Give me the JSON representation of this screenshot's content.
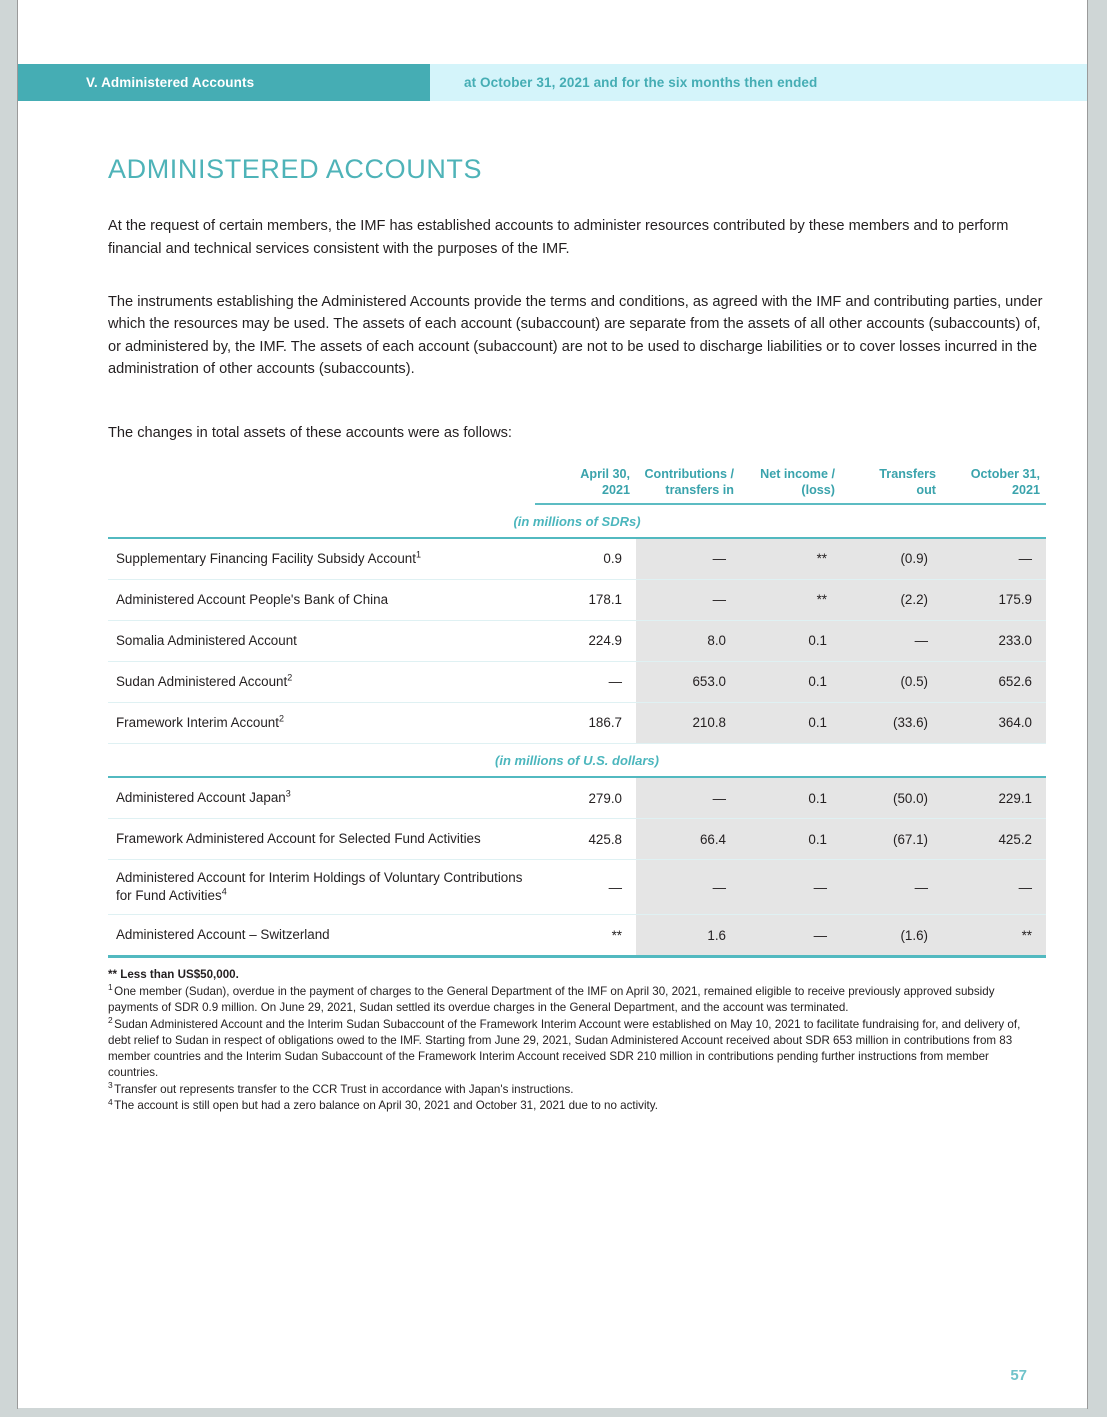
{
  "document": {
    "running_header_left": "V. Administered Accounts",
    "running_header_right": "at October 31, 2021 and for the six months then ended",
    "title": "ADMINISTERED ACCOUNTS",
    "page_number": "57"
  },
  "paragraphs": {
    "p1": "At the request of certain members, the IMF has established accounts to administer resources contributed by these members and to perform financial and technical services consistent with the purposes of the IMF.",
    "p2": "The instruments establishing the Administered Accounts provide the terms and conditions, as agreed with the IMF and contributing parties, under which the resources may be used. The assets of each account (subaccount) are separate from the assets of all other accounts (subaccounts) of, or administered by, the IMF. The assets of each account (subaccount) are not to be used to discharge liabilities or to cover losses incurred in the administration of other accounts (subaccounts).",
    "lead_in": "The changes in total assets of these accounts were as follows:"
  },
  "table": {
    "columns": [
      "",
      "April 30,\n2021",
      "Contributions /\ntransfers in",
      "Net income /\n(loss)",
      "Transfers\nout",
      "October 31,\n2021"
    ],
    "column_headers": [
      {
        "line1": "April 30,",
        "line2": "2021"
      },
      {
        "line1": "Contributions /",
        "line2": "transfers in"
      },
      {
        "line1": "Net income /",
        "line2": "(loss)"
      },
      {
        "line1": "Transfers",
        "line2": "out"
      },
      {
        "line1": "October 31,",
        "line2": "2021"
      }
    ],
    "sections": [
      {
        "unit_label": "(in millions of SDRs)",
        "rows": [
          {
            "label": "Supplementary Financing Facility Subsidy Account",
            "footnote": "1",
            "opening": "0.9",
            "contributions": "—",
            "net_income": "**",
            "transfers_out": "(0.9)",
            "closing": "—"
          },
          {
            "label": "Administered Account People's Bank of China",
            "footnote": "",
            "opening": "178.1",
            "contributions": "—",
            "net_income": "**",
            "transfers_out": "(2.2)",
            "closing": "175.9"
          },
          {
            "label": "Somalia Administered Account",
            "footnote": "",
            "opening": "224.9",
            "contributions": "8.0",
            "net_income": "0.1",
            "transfers_out": "—",
            "closing": "233.0"
          },
          {
            "label": "Sudan Administered Account",
            "footnote": "2",
            "opening": "—",
            "contributions": "653.0",
            "net_income": "0.1",
            "transfers_out": "(0.5)",
            "closing": "652.6"
          },
          {
            "label": "Framework Interim Account",
            "footnote": "2",
            "opening": "186.7",
            "contributions": "210.8",
            "net_income": "0.1",
            "transfers_out": "(33.6)",
            "closing": "364.0"
          }
        ]
      },
      {
        "unit_label": "(in millions of U.S. dollars)",
        "rows": [
          {
            "label": "Administered Account Japan",
            "footnote": "3",
            "opening": "279.0",
            "contributions": "—",
            "net_income": "0.1",
            "transfers_out": "(50.0)",
            "closing": "229.1"
          },
          {
            "label": "Framework Administered Account for Selected Fund Activities",
            "footnote": "",
            "opening": "425.8",
            "contributions": "66.4",
            "net_income": "0.1",
            "transfers_out": "(67.1)",
            "closing": "425.2"
          },
          {
            "label": "Administered Account for Interim Holdings of Voluntary Contributions for Fund Activities",
            "footnote": "4",
            "opening": "—",
            "contributions": "—",
            "net_income": "—",
            "transfers_out": "—",
            "closing": "—"
          },
          {
            "label": "Administered Account – Switzerland",
            "footnote": "",
            "opening": "**",
            "contributions": "1.6",
            "net_income": "—",
            "transfers_out": "(1.6)",
            "closing": "**"
          }
        ]
      }
    ]
  },
  "footnotes": [
    {
      "marker": "**",
      "text": "Less than US$50,000."
    },
    {
      "marker": "1",
      "text": "One member (Sudan), overdue in the payment of charges to the General Department of the IMF on April 30, 2021, remained eligible to receive previously approved subsidy payments of SDR 0.9 million. On June 29, 2021, Sudan settled its overdue charges in the General Department, and the account was terminated."
    },
    {
      "marker": "2",
      "text": "Sudan Administered Account and the Interim Sudan Subaccount of the Framework Interim Account were established on May 10, 2021 to facilitate fundraising for, and delivery of, debt relief to Sudan in respect of obligations owed to the IMF. Starting from June 29, 2021, Sudan Administered Account received about SDR 653 million in contributions from 83 member countries and the Interim Sudan Subaccount of the Framework Interim Account received SDR 210 million in contributions pending further instructions from member countries."
    },
    {
      "marker": "3",
      "text": "Transfer out represents transfer to the CCR Trust in accordance with Japan's instructions."
    },
    {
      "marker": "4",
      "text": "The account is still open but had a zero balance on April 30, 2021 and October 31, 2021 due to no activity."
    }
  ],
  "colors": {
    "header_band_left": "#45adb4",
    "header_band_right": "#d4f4fa",
    "accent_teal": "#4eb3b8",
    "rule_teal": "#52b9c0",
    "shaded_column": "#e5e5e5",
    "text": "#231f20"
  }
}
